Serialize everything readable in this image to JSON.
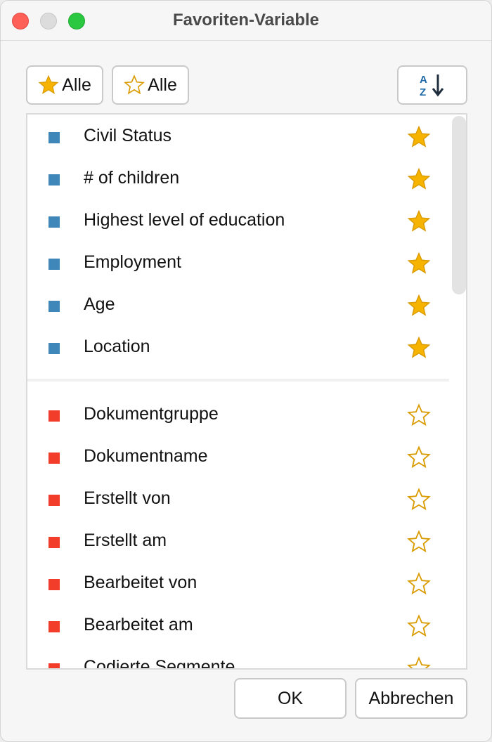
{
  "window": {
    "title": "Favoriten-Variable"
  },
  "toolbar": {
    "favorite_all_label": "Alle",
    "unfavorite_all_label": "Alle",
    "sort_icon": "sort-alpha-az-icon"
  },
  "colors": {
    "document_variable": "#3f87b8",
    "system_variable": "#f23d2a",
    "star": "#f6b400",
    "star_outline": "#d99b00"
  },
  "variables": {
    "document": [
      {
        "label": "Civil Status",
        "favorite": true
      },
      {
        "label": "# of children",
        "favorite": true
      },
      {
        "label": "Highest level of education",
        "favorite": true
      },
      {
        "label": "Employment",
        "favorite": true
      },
      {
        "label": "Age",
        "favorite": true
      },
      {
        "label": "Location",
        "favorite": true
      }
    ],
    "system": [
      {
        "label": "Dokumentgruppe",
        "favorite": false
      },
      {
        "label": "Dokumentname",
        "favorite": false
      },
      {
        "label": "Erstellt von",
        "favorite": false
      },
      {
        "label": "Erstellt am",
        "favorite": false
      },
      {
        "label": "Bearbeitet von",
        "favorite": false
      },
      {
        "label": "Bearbeitet am",
        "favorite": false
      },
      {
        "label": "Codierte Segmente",
        "favorite": false
      }
    ]
  },
  "buttons": {
    "ok": "OK",
    "cancel": "Abbrechen"
  }
}
